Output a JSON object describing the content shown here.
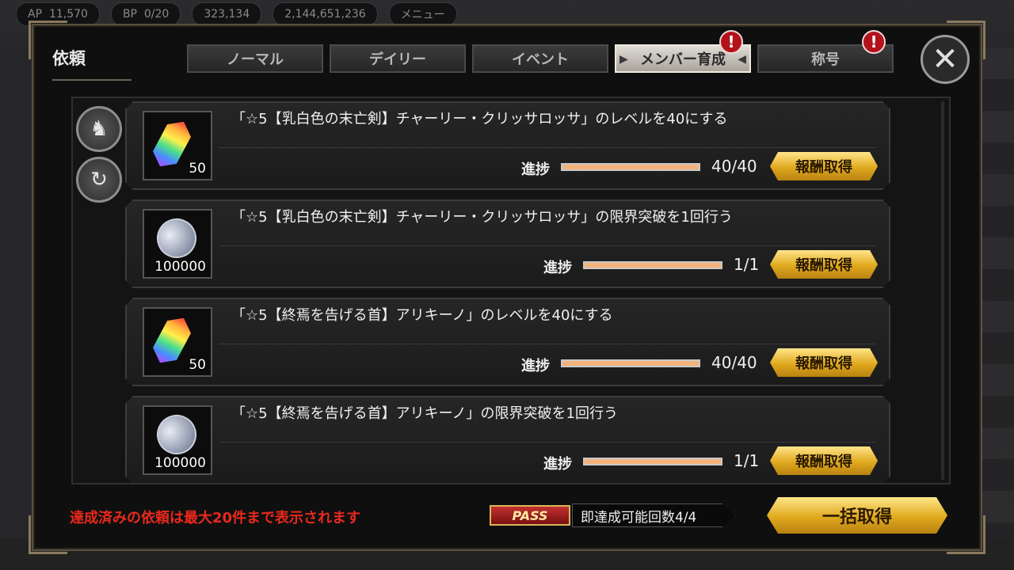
{
  "hud": {
    "ap": "AP",
    "ap_value": "11,570",
    "bp": "BP",
    "bp_value": "0/20",
    "gem_value": "323,134",
    "coin_value": "2,144,651,236",
    "menu": "メニュー"
  },
  "panel": {
    "title": "依頼"
  },
  "tabs": [
    {
      "label": "ノーマル",
      "active": false,
      "alert": false
    },
    {
      "label": "デイリー",
      "active": false,
      "alert": false
    },
    {
      "label": "イベント",
      "active": false,
      "alert": false
    },
    {
      "label": "メンバー育成",
      "active": true,
      "alert": true
    },
    {
      "label": "称号",
      "active": false,
      "alert": true
    }
  ],
  "alert_symbol": "!",
  "close_symbol": "✕",
  "side_buttons": {
    "filter_icon": "knight-helmet-icon",
    "refresh_icon": "refresh-icon"
  },
  "quests": [
    {
      "description": "「☆5【乳白色の末亡剣】チャーリー・クリッサロッサ」のレベルを40にする",
      "reward_icon": "crystal-icon",
      "reward_qty": "50",
      "progress_label": "進捗",
      "progress_value": "40/40",
      "progress_fraction": 1.0,
      "button_label": "報酬取得"
    },
    {
      "description": "「☆5【乳白色の末亡剣】チャーリー・クリッサロッサ」の限界突破を1回行う",
      "reward_icon": "coin-icon",
      "reward_qty": "100000",
      "progress_label": "進捗",
      "progress_value": "1/1",
      "progress_fraction": 1.0,
      "button_label": "報酬取得"
    },
    {
      "description": "「☆5【終焉を告げる首】アリキーノ」のレベルを40にする",
      "reward_icon": "crystal-icon",
      "reward_qty": "50",
      "progress_label": "進捗",
      "progress_value": "40/40",
      "progress_fraction": 1.0,
      "button_label": "報酬取得"
    },
    {
      "description": "「☆5【終焉を告げる首】アリキーノ」の限界突破を1回行う",
      "reward_icon": "coin-icon",
      "reward_qty": "100000",
      "progress_label": "進捗",
      "progress_value": "1/1",
      "progress_fraction": 1.0,
      "button_label": "報酬取得"
    }
  ],
  "footer": {
    "note": "達成済みの依頼は最大20件まで表示されます",
    "pass_badge": "PASS",
    "pass_text": "即達成可能回数4/4",
    "bulk_button": "一括取得"
  },
  "colors": {
    "accent_gold": "#e0a91e",
    "note_red": "#e8291c",
    "progress_fill": "#f3b27a",
    "alert_red": "#b3121a"
  }
}
